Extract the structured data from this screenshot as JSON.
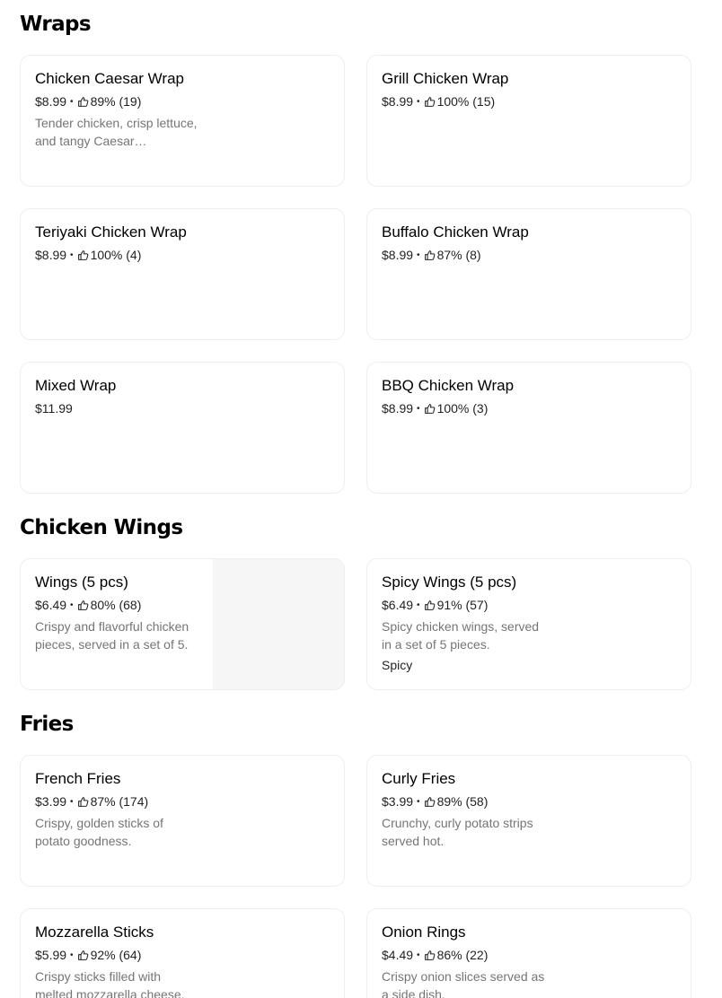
{
  "sections": [
    {
      "title": "Wraps",
      "items": [
        {
          "name": "Chicken Caesar Wrap",
          "price": "$8.99",
          "rating": "89% (19)",
          "description": "Tender chicken, crisp lettuce, and tangy Caesar…"
        },
        {
          "name": "Grill Chicken Wrap",
          "price": "$8.99",
          "rating": "100% (15)"
        },
        {
          "name": "Teriyaki Chicken Wrap",
          "price": "$8.99",
          "rating": "100% (4)"
        },
        {
          "name": "Buffalo Chicken Wrap",
          "price": "$8.99",
          "rating": "87% (8)"
        },
        {
          "name": "Mixed Wrap",
          "price": "$11.99"
        },
        {
          "name": "BBQ Chicken Wrap",
          "price": "$8.99",
          "rating": "100% (3)"
        }
      ]
    },
    {
      "title": "Chicken Wings",
      "items": [
        {
          "name": "Wings (5 pcs)",
          "price": "$6.49",
          "rating": "80% (68)",
          "description": "Crispy and flavorful chicken pieces, served in a set of 5."
        },
        {
          "name": "Spicy Wings (5 pcs)",
          "price": "$6.49",
          "rating": "91% (57)",
          "description": "Spicy chicken wings, served in a set of 5 pieces.",
          "tag": "Spicy"
        }
      ]
    },
    {
      "title": "Fries",
      "items": [
        {
          "name": "French Fries",
          "price": "$3.99",
          "rating": "87% (174)",
          "description": "Crispy, golden sticks of potato goodness."
        },
        {
          "name": "Curly Fries",
          "price": "$3.99",
          "rating": "89% (58)",
          "description": "Crunchy, curly potato strips served hot."
        },
        {
          "name": "Mozzarella Sticks",
          "price": "$5.99",
          "rating": "92% (64)",
          "description": "Crispy sticks filled with melted mozzarella cheese."
        },
        {
          "name": "Onion Rings",
          "price": "$4.49",
          "rating": "86% (22)",
          "description": "Crispy onion slices served as a side dish."
        }
      ]
    }
  ],
  "icons": {
    "rating": "thumbs-up-icon",
    "separator": "•"
  }
}
